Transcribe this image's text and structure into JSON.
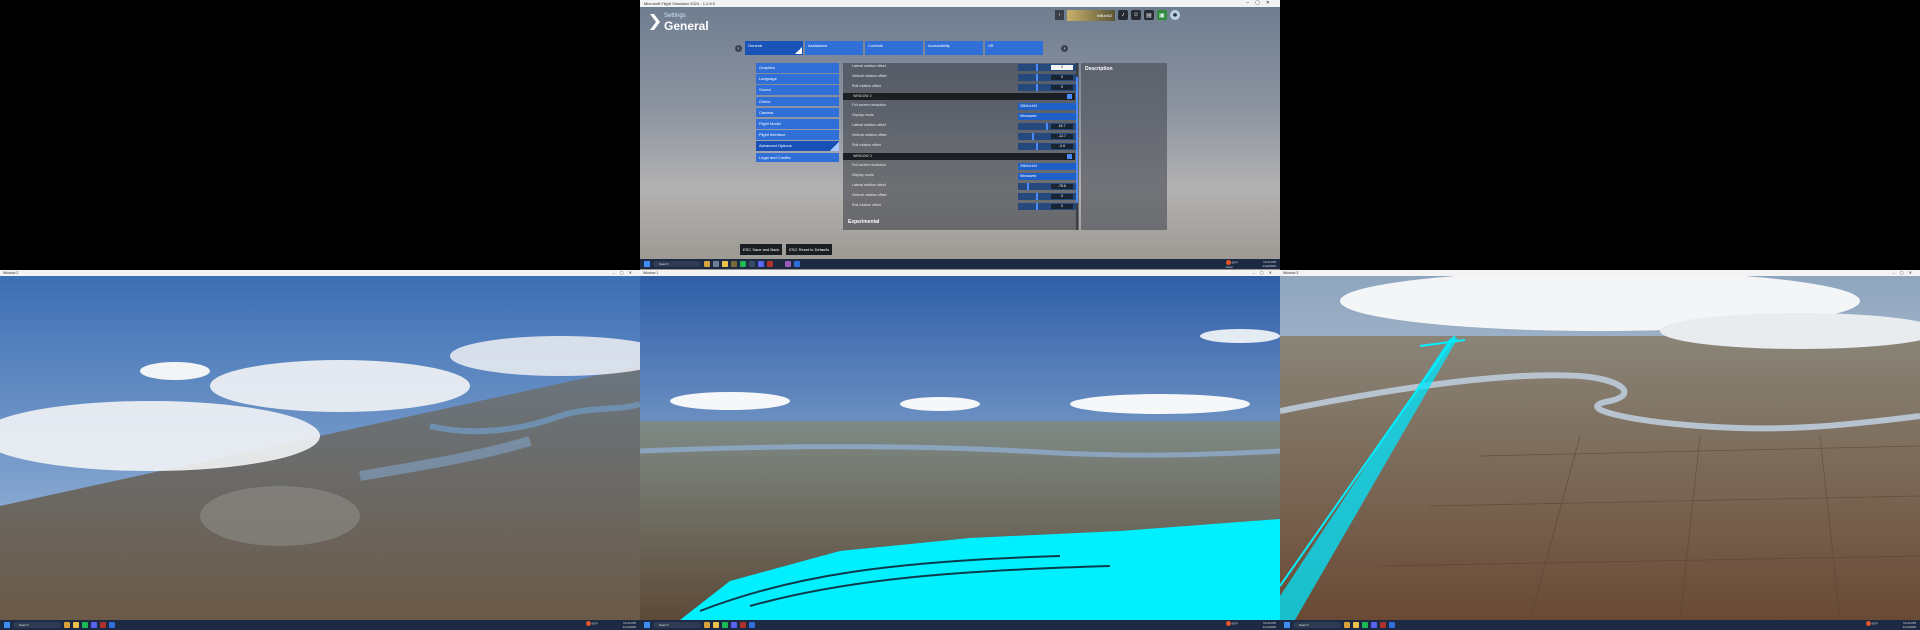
{
  "settings_window": {
    "title": "Microsoft Flight Simulator 2024 - 1.2.8.0",
    "header_small": "Settings",
    "header_big": "General",
    "username": "Wiliz462",
    "tabs": [
      "General",
      "Assistance",
      "Controls",
      "Accessibility",
      "VR"
    ],
    "active_tab": 0,
    "nav": [
      "Graphics",
      "Language",
      "Sound",
      "Online",
      "Camera",
      "Flight Model",
      "Flight Interface",
      "Advanced Options",
      "Legal and Credits"
    ],
    "active_nav": 7,
    "rows_top": [
      {
        "label": "Lateral rotation offset",
        "value": "0"
      },
      {
        "label": "Vertical rotation offset",
        "value": "0"
      },
      {
        "label": "Roll rotation offset",
        "value": "0"
      }
    ],
    "window2": {
      "title": "WINDOW 2",
      "resolution_label": "Full screen resolution",
      "resolution": "2560x1440",
      "display_label": "Display mode",
      "display": "Windowed",
      "lateral": {
        "label": "Lateral rotation offset",
        "value": "16.7"
      },
      "vertical": {
        "label": "Vertical rotation offset",
        "value": "-12.7"
      },
      "roll": {
        "label": "Roll rotation offset",
        "value": "-0.6"
      }
    },
    "window3": {
      "title": "WINDOW 3",
      "resolution_label": "Full screen resolution",
      "resolution": "2560x1440",
      "display_label": "Display mode",
      "display": "Windowed",
      "lateral": {
        "label": "Lateral rotation offset",
        "value": "-75.6"
      },
      "vertical": {
        "label": "Vertical rotation offset",
        "value": "0"
      },
      "roll": {
        "label": "Roll rotation offset",
        "value": "0"
      }
    },
    "experimental": "Experimental",
    "description_title": "Description",
    "buttons": {
      "save": "ESC Save and Back",
      "reset": "ESC Reset to Defaults"
    }
  },
  "taskbar": {
    "search": "Search",
    "weather": "65°F",
    "weather_sub": "Clear",
    "time": "12:34 PM",
    "date": "1/12/2025"
  },
  "scene_titles": [
    "Window 2",
    "Window 1",
    "Window 3"
  ],
  "colors": {
    "accent": "#2f6fd7",
    "overlay": "#00f0ff"
  }
}
